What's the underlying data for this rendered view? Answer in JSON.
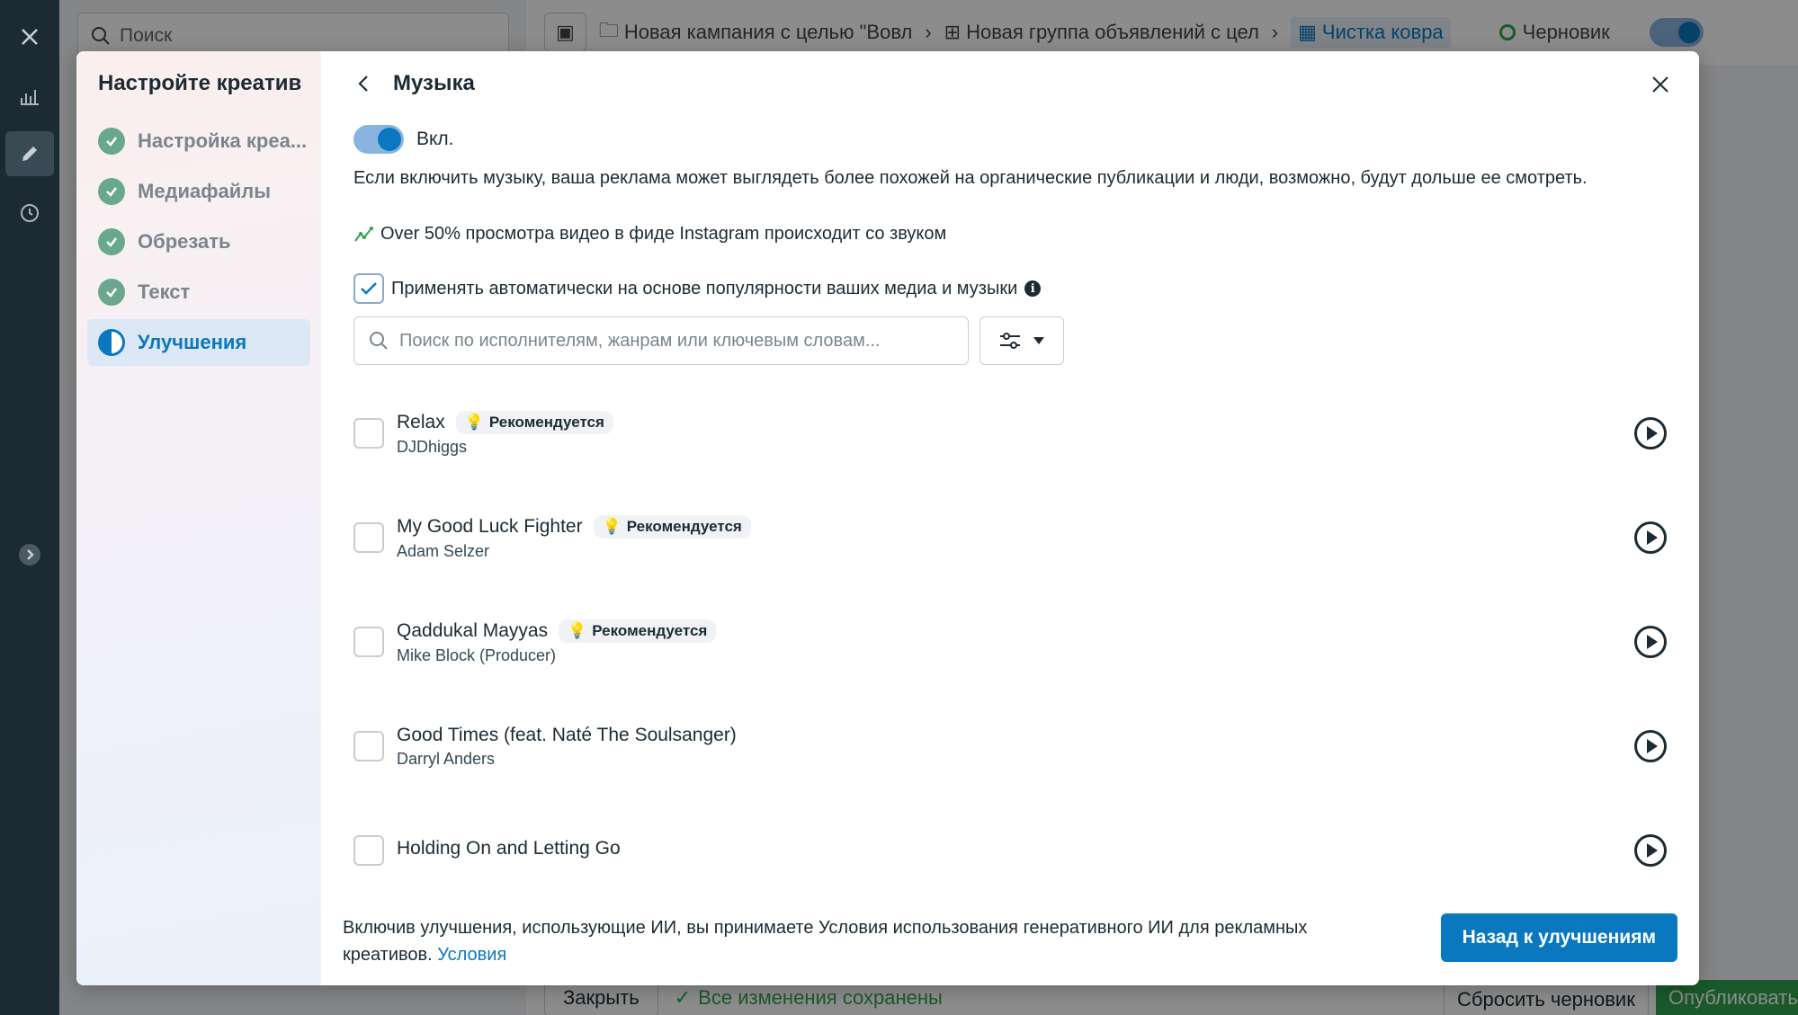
{
  "background": {
    "search_placeholder": "Поиск",
    "breadcrumbs": [
      {
        "label": "Новая кампания с целью \"Вовл"
      },
      {
        "label": "Новая группа объявлений с цел"
      },
      {
        "label": "Чистка ковра"
      }
    ],
    "status": "Черновик",
    "close_label": "Закрыть",
    "saved_text": "Все изменения сохранены",
    "reset_label": "Сбросить черновик",
    "publish_label": "Опубликовать"
  },
  "sidebar": {
    "title": "Настройте креатив",
    "steps": [
      {
        "label": "Настройка креа...",
        "state": "done"
      },
      {
        "label": "Медиафайлы",
        "state": "done"
      },
      {
        "label": "Обрезать",
        "state": "done"
      },
      {
        "label": "Текст",
        "state": "done"
      },
      {
        "label": "Улучшения",
        "state": "active"
      }
    ]
  },
  "main": {
    "title": "Музыка",
    "toggle_label": "Вкл.",
    "toggle_on": true,
    "description": "Если включить музыку, ваша реклама может выглядеть более похожей на органические публикации и люди, возможно, будут дольше ее смотреть.",
    "stat_text": "Over 50% просмотра видео в фиде Instagram происходит со звуком",
    "auto_apply_label": "Применять автоматически на основе популярности ваших медиа и музыки",
    "auto_apply_checked": true,
    "search_placeholder": "Поиск по исполнителям, жанрам или ключевым словам...",
    "recommended_label": "Рекомендуется",
    "tracks": [
      {
        "title": "Relax",
        "artist": "DJDhiggs",
        "recommended": true
      },
      {
        "title": "My Good Luck Fighter",
        "artist": "Adam Selzer",
        "recommended": true
      },
      {
        "title": "Qaddukal Mayyas",
        "artist": "Mike Block (Producer)",
        "recommended": true
      },
      {
        "title": "Good Times (feat. Naté The Soulsanger)",
        "artist": "Darryl Anders",
        "recommended": false
      },
      {
        "title": "Holding On and Letting Go",
        "artist": "",
        "recommended": false
      }
    ]
  },
  "footer": {
    "text": "Включив улучшения, использующие ИИ, вы принимаете Условия использования генеративного ИИ для рекламных креативов.",
    "link_label": "Условия",
    "primary_label": "Назад к улучшениям"
  },
  "colors": {
    "accent": "#0a78be",
    "success": "#69a88e"
  }
}
